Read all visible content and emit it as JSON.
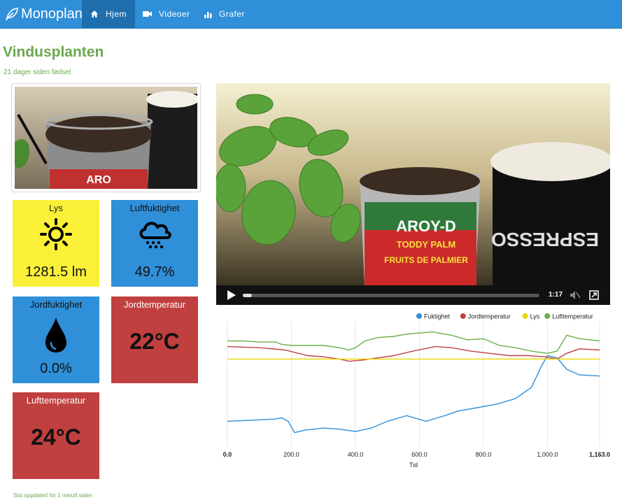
{
  "navbar": {
    "brand": "Monoplant",
    "items": [
      {
        "label": "Hjem",
        "icon": "home-icon",
        "active": true
      },
      {
        "label": "Videoer",
        "icon": "video-camera-icon",
        "active": false
      },
      {
        "label": "Grafer",
        "icon": "bar-chart-icon",
        "active": false
      }
    ],
    "color": "#2f8fd8"
  },
  "page": {
    "title": "Vindusplanten",
    "subtitle": "21 dager siden fødsel",
    "footer": "Sist oppdatert for 1 minutt siden",
    "accent": "#6aa84f"
  },
  "tiles": [
    {
      "label": "Lys",
      "value": "1281.5 lm",
      "icon": "sun-icon",
      "color": "#fbf038"
    },
    {
      "label": "Luftfuktighet",
      "value": "49.7%",
      "icon": "rain-cloud-icon",
      "color": "#2f8fd8"
    },
    {
      "label": "Jordfuktighet",
      "value": "0.0%",
      "icon": "water-drop-icon",
      "color": "#2f8fd8"
    },
    {
      "label": "Jordtemperatur",
      "value": "22°C",
      "icon": "",
      "color": "#c04040"
    },
    {
      "label": "Lufttemperatur",
      "value": "24°C",
      "icon": "",
      "color": "#c04040"
    }
  ],
  "video": {
    "time": "1:17",
    "progress": 0.03
  },
  "chart_data": {
    "type": "line",
    "xlabel": "Tid",
    "xlim": [
      0,
      1163
    ],
    "x_ticks": [
      "0.0",
      "200.0",
      "400.0",
      "600.0",
      "800.0",
      "1,000.0",
      "1,163.0"
    ],
    "legend_position": "top-right",
    "series": [
      {
        "name": "Fuktighet",
        "color": "#2f8fd8",
        "x": [
          0,
          80,
          150,
          170,
          190,
          210,
          240,
          300,
          350,
          400,
          450,
          500,
          560,
          620,
          680,
          720,
          780,
          840,
          900,
          950,
          980,
          1000,
          1030,
          1060,
          1100,
          1163
        ],
        "y": [
          22,
          23,
          24,
          25,
          22,
          12,
          14,
          16,
          15,
          13,
          16,
          22,
          27,
          22,
          27,
          31,
          34,
          37,
          42,
          52,
          70,
          80,
          78,
          68,
          63,
          62
        ]
      },
      {
        "name": "Jordtemperatur",
        "color": "#c04040",
        "x": [
          0,
          100,
          180,
          250,
          300,
          350,
          380,
          420,
          470,
          520,
          580,
          650,
          700,
          760,
          820,
          880,
          940,
          990,
          1030,
          1060,
          1100,
          1163
        ],
        "y": [
          88,
          87,
          85,
          80,
          79,
          77,
          75,
          76,
          78,
          80,
          84,
          88,
          87,
          84,
          82,
          80,
          80,
          79,
          77,
          82,
          86,
          85
        ]
      },
      {
        "name": "Lys",
        "color": "#e8d800",
        "x": [
          0,
          1163
        ],
        "y": [
          77,
          77
        ]
      },
      {
        "name": "Lufttemperatur",
        "color": "#6ab04c",
        "x": [
          0,
          50,
          100,
          150,
          170,
          200,
          250,
          300,
          350,
          380,
          400,
          430,
          470,
          520,
          560,
          600,
          640,
          700,
          750,
          800,
          850,
          900,
          950,
          1000,
          1030,
          1060,
          1100,
          1163
        ],
        "y": [
          93,
          93,
          92,
          92,
          90,
          89,
          89,
          89,
          87,
          85,
          87,
          93,
          96,
          97,
          99,
          100,
          101,
          98,
          94,
          95,
          89,
          87,
          84,
          82,
          84,
          98,
          95,
          93
        ]
      }
    ],
    "ylim": [
      0,
      110
    ]
  }
}
